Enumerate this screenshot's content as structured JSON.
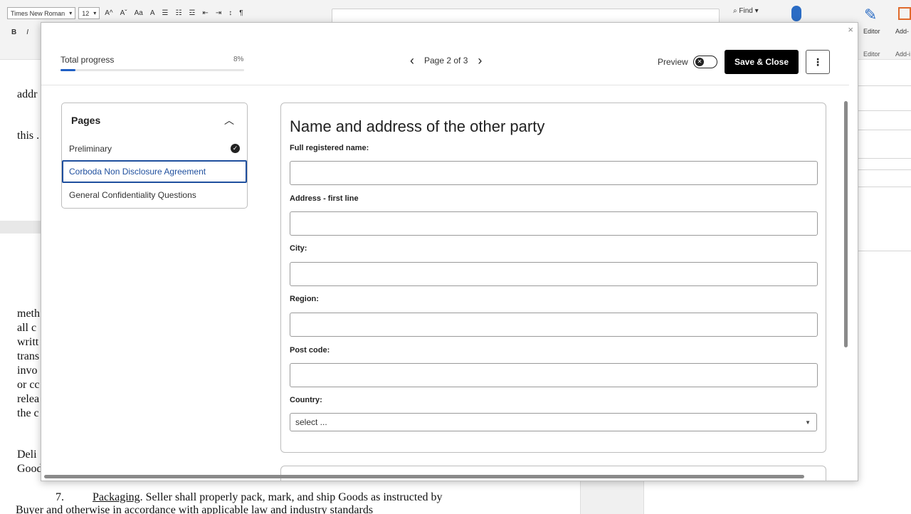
{
  "word": {
    "font_name": "Times New Roman",
    "font_size": "12",
    "ribbon_glyphs": [
      "A^",
      "Aˇ",
      "Aa",
      "A"
    ],
    "row2_glyphs": [
      "B",
      "I"
    ],
    "find_label": "Find",
    "editor_label": "Editor",
    "editor_group": "Editor",
    "addins_label": "Add-",
    "addins_group": "Add-i",
    "doc_fragments": [
      "addr",
      "this .",
      "meth",
      "all c",
      "writt",
      "trans",
      "invo",
      "or cc",
      "relea",
      "the c",
      "Deli",
      "Good"
    ],
    "doc_bottom_line1_num": "7.",
    "doc_bottom_line1_underlined": "Packaging",
    "doc_bottom_line1_rest": ". Seller shall properly pack, mark, and ship Goods as instructed by",
    "doc_bottom_line2": "Buyer and otherwise in accordance with applicable law and industry standards"
  },
  "dialog": {
    "close_glyph": "×",
    "progress": {
      "label": "Total progress",
      "percent_text": "8%",
      "value": 0.08
    },
    "pager": {
      "text": "Page 2 of 3",
      "prev_glyph": "‹",
      "next_glyph": "›"
    },
    "preview_label": "Preview",
    "preview_on": false,
    "save_label": "Save & Close",
    "more_glyph": "⋮",
    "pages": {
      "title": "Pages",
      "items": [
        {
          "label": "Preliminary",
          "completed": true
        },
        {
          "label": "Corboda Non Disclosure Agreement",
          "active": true
        },
        {
          "label": "General Confidentiality Questions"
        }
      ]
    },
    "form": {
      "title": "Name and address of the other party",
      "fields": [
        {
          "label": "Full registered name:",
          "value": ""
        },
        {
          "label": "Address - first line",
          "value": ""
        },
        {
          "label": "City:",
          "value": ""
        },
        {
          "label": "Region:",
          "value": ""
        },
        {
          "label": "Post code:",
          "value": ""
        }
      ],
      "country": {
        "label": "Country:",
        "placeholder": "select ..."
      }
    }
  }
}
